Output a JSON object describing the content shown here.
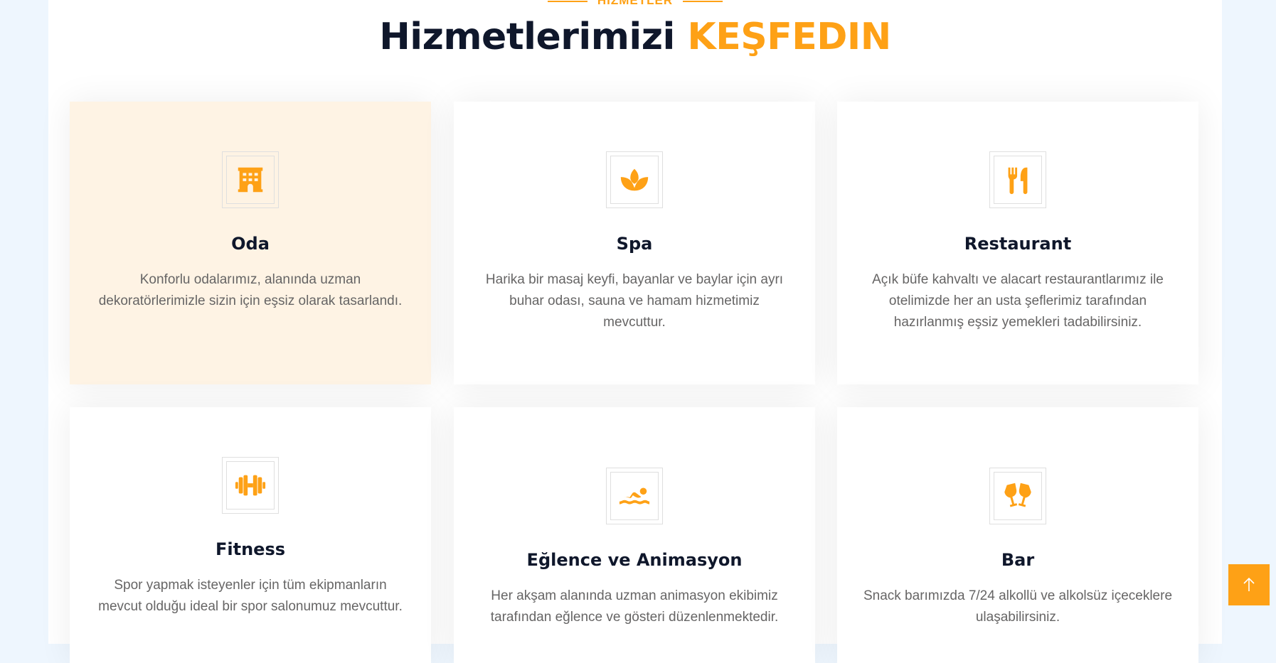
{
  "section": {
    "eyebrow": "HİZMETLER",
    "title_main": "Hizmetlerimizi",
    "title_accent": "KEŞFEDIN"
  },
  "colors": {
    "accent": "#fea116",
    "dark": "#0f172b",
    "active_card_bg": "#fef3e4"
  },
  "services": [
    {
      "icon": "hotel-icon",
      "title": "Oda",
      "text": "Konforlu odalarımız, alanında uzman dekoratörlerimizle sizin için eşsiz olarak tasarlandı."
    },
    {
      "icon": "spa-icon",
      "title": "Spa",
      "text": "Harika bir masaj keyfi, bayanlar ve baylar için ayrı buhar odası, sauna ve hamam hizmetimiz mevcuttur."
    },
    {
      "icon": "utensils-icon",
      "title": "Restaurant",
      "text": "Açık büfe kahvaltı ve alacart restaurantlarımız ile otelimizde her an usta şeflerimiz tarafından hazırlanmış eşsiz yemekleri tadabilirsiniz."
    },
    {
      "icon": "dumbbell-icon",
      "title": "Fitness",
      "text": "Spor yapmak isteyenler için tüm ekipmanların mevcut olduğu ideal bir spor salonumuz mevcuttur."
    },
    {
      "icon": "swimmer-icon",
      "title": "Eğlence ve Animasyon",
      "text": "Her akşam alanında uzman animasyon ekibimiz tarafından eğlence ve gösteri düzenlenmektedir."
    },
    {
      "icon": "glasses-cheers-icon",
      "title": "Bar",
      "text": "Snack barımızda 7/24 alkollü ve alkolsüz içeceklere ulaşabilirsiniz."
    }
  ],
  "back_to_top_icon": "arrow-up-icon"
}
